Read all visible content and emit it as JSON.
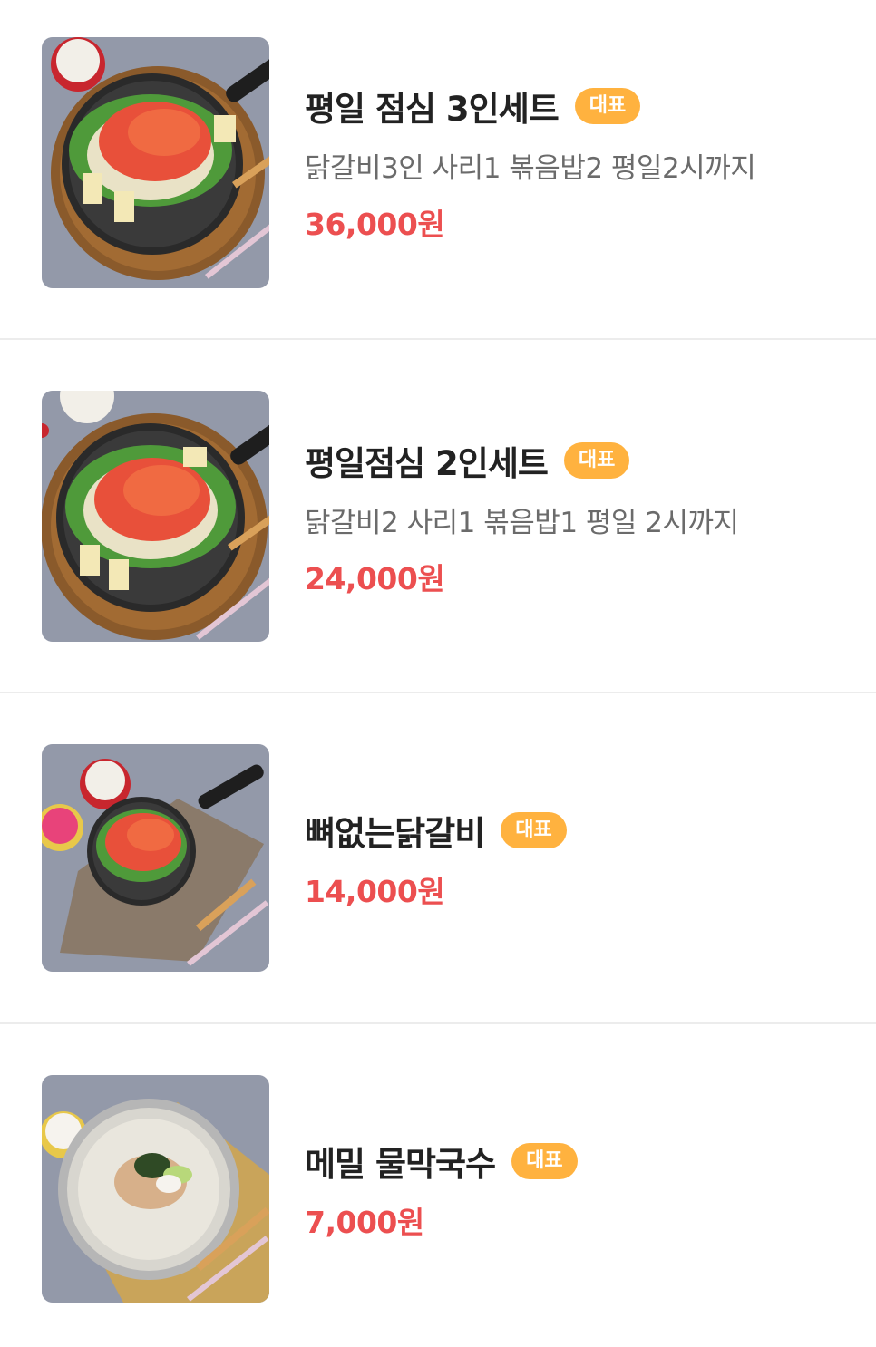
{
  "menu": {
    "items": [
      {
        "name": "평일 점심 3인세트",
        "badge": "대표",
        "description": "닭갈비3인 사리1 볶음밥2 평일2시까지",
        "price": "36,000원",
        "image": "dakgalbi-pan-photo"
      },
      {
        "name": "평일점심 2인세트",
        "badge": "대표",
        "description": "닭갈비2 사리1 볶음밥1 평일 2시까지",
        "price": "24,000원",
        "image": "dakgalbi-pan-photo"
      },
      {
        "name": "뼈없는닭갈비",
        "badge": "대표",
        "description": "",
        "price": "14,000원",
        "image": "small-dakgalbi-pan-photo"
      },
      {
        "name": "메밀 물막국수",
        "badge": "대표",
        "description": "",
        "price": "7,000원",
        "image": "buckwheat-noodle-bowl-photo"
      }
    ]
  },
  "colors": {
    "badge": "#ffb23f",
    "price": "#ec4f50",
    "divider": "#ececec"
  }
}
